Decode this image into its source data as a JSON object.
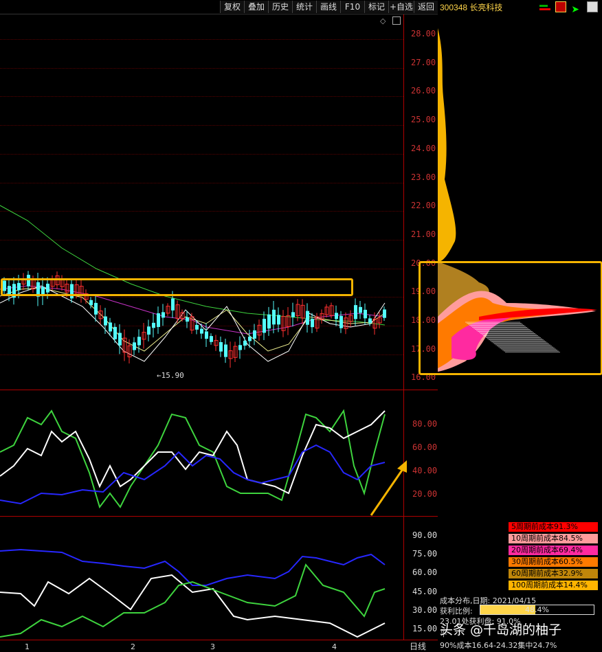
{
  "toolbar": {
    "buttons": [
      "复权",
      "叠加",
      "历史",
      "统计",
      "画线",
      "F10",
      "标记",
      "+自选",
      "返回"
    ]
  },
  "stock": {
    "code_name": "300348 长亮科技"
  },
  "price_axis": [
    "28.00",
    "27.00",
    "26.00",
    "25.00",
    "24.00",
    "23.00",
    "22.00",
    "21.00",
    "20.00",
    "19.00",
    "18.00",
    "17.00",
    "16.00"
  ],
  "ind1_axis": [
    "80.00",
    "60.00",
    "40.00",
    "20.00"
  ],
  "ind2_axis": [
    "90.00",
    "75.00",
    "60.00",
    "45.00",
    "30.00",
    "15.00"
  ],
  "low_marker": "←15.90",
  "x_labels": [
    "1",
    "2",
    "3",
    "4"
  ],
  "day_tab": "日线",
  "legend": [
    {
      "text": "5周期前成本91.3%",
      "color": "#ff0000"
    },
    {
      "text": "10周期前成本84.5%",
      "color": "#ff9c9c"
    },
    {
      "text": "20周期前成本69.4%",
      "color": "#ff2aa0"
    },
    {
      "text": "30周期前成本60.5%",
      "color": "#ff7a00"
    },
    {
      "text": "60周期前成本32.9%",
      "color": "#c0860a"
    },
    {
      "text": "100周期前成本14.4%",
      "color": "#ffb400"
    }
  ],
  "info": {
    "date_line": "成本分布,日期: 2021/04/15",
    "profit_label": "获利比例:",
    "profit_value": "48.4%",
    "profit_fraction": 0.484,
    "line3": "23.01处获利盘: 91.0%",
    "line4": "平",
    "line5": "90%成本16.64-24.32集中24.7%"
  },
  "watermark": "头条 @千岛湖的柚子",
  "colors": {
    "accent": "#f5b400",
    "up": "#ff3030",
    "down": "#54fcfc"
  }
}
